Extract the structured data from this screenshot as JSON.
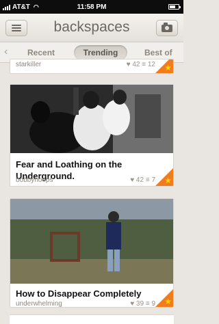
{
  "status_bar": {
    "carrier": "AT&T",
    "time": "11:58 PM"
  },
  "nav": {
    "title": "backspaces",
    "menu_icon": "hamburger-icon",
    "camera_icon": "camera-icon"
  },
  "tabs": {
    "items": [
      "Recent",
      "Trending",
      "Best of"
    ],
    "selected": "Trending"
  },
  "posts": [
    {
      "title": "",
      "author": "starkiller",
      "likes": "42",
      "comments": "12",
      "starred": true
    },
    {
      "title": "Fear and Loathing on the Underground.",
      "author": "bobbyhoops",
      "likes": "42",
      "comments": "7",
      "starred": true
    },
    {
      "title": "How to Disappear Completely",
      "author": "underwhelming",
      "likes": "39",
      "comments": "9",
      "starred": true
    }
  ],
  "colors": {
    "accent": "#f07c1e",
    "star": "#ffd400",
    "background": "#e9e6e1"
  }
}
